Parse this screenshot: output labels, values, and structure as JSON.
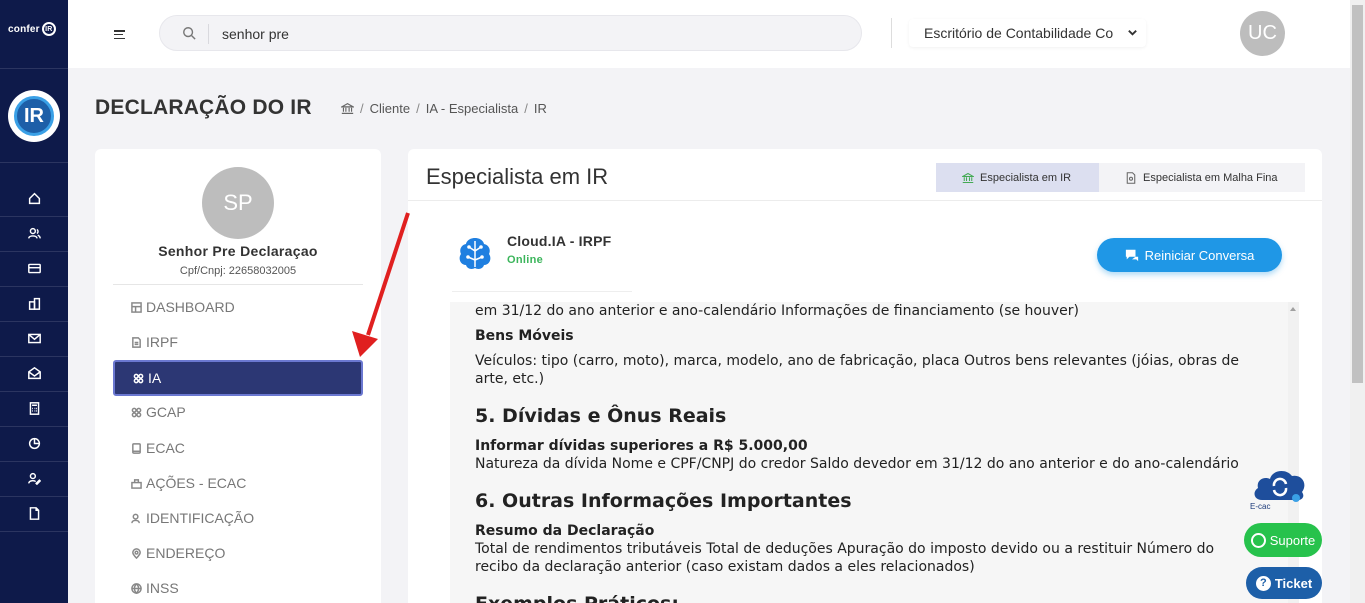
{
  "app": {
    "logo_small": "confer",
    "logo_small_ring": "IR",
    "logo_big": "IR"
  },
  "rail": {
    "icons": [
      "home-icon",
      "users-icon",
      "card-icon",
      "buildings-icon",
      "mail-icon",
      "mail-open-icon",
      "calculator-icon",
      "pie-chart-icon",
      "user-edit-icon",
      "document-icon"
    ]
  },
  "header": {
    "search_value": "senhor pre",
    "office_select": "Escritório de Contabilidade Co",
    "user_initials": "UC"
  },
  "page": {
    "title": "DECLARAÇÃO DO IR",
    "breadcrumb": [
      "Cliente",
      "IA - Especialista",
      "IR"
    ]
  },
  "client": {
    "initials": "SP",
    "name": "Senhor Pre Declaraçao",
    "doc": "Cpf/Cnpj: 22658032005"
  },
  "menu": [
    {
      "label": "DASHBOARD",
      "icon": "dashboard-icon",
      "active": false
    },
    {
      "label": "IRPF",
      "icon": "file-icon",
      "active": false
    },
    {
      "label": "IA",
      "icon": "ai-icon",
      "active": true
    },
    {
      "label": "GCAP",
      "icon": "gcap-icon",
      "active": false
    },
    {
      "label": "ECAC",
      "icon": "ecac-icon",
      "active": false
    },
    {
      "label": "AÇÕES - ECAC",
      "icon": "actions-icon",
      "active": false
    },
    {
      "label": "IDENTIFICAÇÃO",
      "icon": "identity-icon",
      "active": false
    },
    {
      "label": "ENDEREÇO",
      "icon": "location-icon",
      "active": false
    },
    {
      "label": "INSS",
      "icon": "globe-icon",
      "active": false
    }
  ],
  "main": {
    "title": "Especialista em IR",
    "tabs": [
      {
        "label": "Especialista em IR",
        "active": true
      },
      {
        "label": "Especialista em Malha Fina",
        "active": false
      }
    ],
    "bot": {
      "name": "Cloud.IA - IRPF",
      "status": "Online",
      "restart_label": "Reiniciar Conversa"
    },
    "chat": {
      "line_top": "em 31/12 do ano anterior e ano-calendário Informações de financiamento (se houver)",
      "bens_moveis_title": "Bens Móveis",
      "bens_moveis_text": "Veículos: tipo (carro, moto), marca, modelo, ano de fabricação, placa Outros bens relevantes (jóias, obras de arte, etc.)",
      "section5_title": "5. Dívidas e Ônus Reais",
      "dividas_title": "Informar dívidas superiores a R$ 5.000,00",
      "dividas_text": "Natureza da dívida Nome e CPF/CNPJ do credor Saldo devedor em 31/12 do ano anterior e do ano-calendário",
      "section6_title": "6. Outras Informações Importantes",
      "resumo_title": "Resumo da Declaração",
      "resumo_text": "Total de rendimentos tributáveis Total de deduções Apuração do imposto devido ou a restituir Número do recibo da declaração anterior (caso existam dados a eles relacionados)",
      "section_next_title": "Exemplos Práticos:"
    }
  },
  "widgets": {
    "ecac_label": "E-cac",
    "suporte_label": "Suporte",
    "ticket_label": "Ticket"
  },
  "colors": {
    "rail": "#0e1a4a",
    "active_menu": "#2c3774",
    "primary_button": "#1f97e6",
    "online": "#3bb55b",
    "support": "#27c24c",
    "annotation_arrow": "#e02020"
  }
}
